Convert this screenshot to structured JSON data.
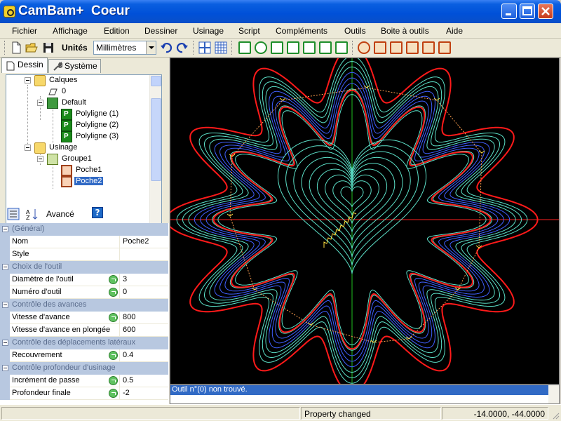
{
  "window": {
    "app_name": "CamBam+",
    "document": "Coeur"
  },
  "menu": [
    "Fichier",
    "Affichage",
    "Edition",
    "Dessiner",
    "Usinage",
    "Script",
    "Compléments",
    "Outils",
    "Boite à outils",
    "Aide"
  ],
  "toolbar": {
    "units_label": "Unités",
    "units_value": "Millimètres"
  },
  "tabs": {
    "drawing": "Dessin",
    "system": "Système"
  },
  "tree": {
    "layers": "Calques",
    "layer0": "0",
    "layer_default": "Default",
    "polylines": [
      "Polyligne (1)",
      "Polyligne (2)",
      "Polyligne (3)"
    ],
    "machining": "Usinage",
    "group": "Groupe1",
    "pockets": [
      "Poche1",
      "Poche2"
    ],
    "selected": "Poche2"
  },
  "propbar": {
    "advanced_label": "Avancé"
  },
  "properties": {
    "cat_general": "(Général)",
    "name_label": "Nom",
    "name_value": "Poche2",
    "style_label": "Style",
    "style_value": "",
    "cat_tool": "Choix de l'outil",
    "tool_diam_label": "Diamètre de l'outil",
    "tool_diam_value": "3",
    "tool_num_label": "Numéro d'outil",
    "tool_num_value": "0",
    "cat_feeds": "Contrôle des avances",
    "feed_label": "Vitesse d'avance",
    "feed_value": "800",
    "plunge_label": "Vitesse d'avance en plongée",
    "plunge_value": "600",
    "cat_lateral": "Contrôle des déplacements latéraux",
    "stepover_label": "Recouvrement",
    "stepover_value": "0.4",
    "cat_depth": "Contrôle profondeur d'usinage",
    "depth_inc_label": "Incrément de passe",
    "depth_inc_value": "0.5",
    "depth_final_label": "Profondeur finale",
    "depth_final_value": "-2"
  },
  "messages": {
    "line1": "Outil n°(0) non trouvé."
  },
  "status": {
    "message": "Property changed",
    "coords": "-14.0000, -44.0000"
  },
  "colors": {
    "outline": "#ff1a1a",
    "toolpath_outer": "#4060ff",
    "toolpath_inner": "#5ce0c8",
    "axis_x": "#ff2020",
    "axis_y": "#20c020",
    "rapid": "#ffa050",
    "plunge": "#ffe040"
  }
}
